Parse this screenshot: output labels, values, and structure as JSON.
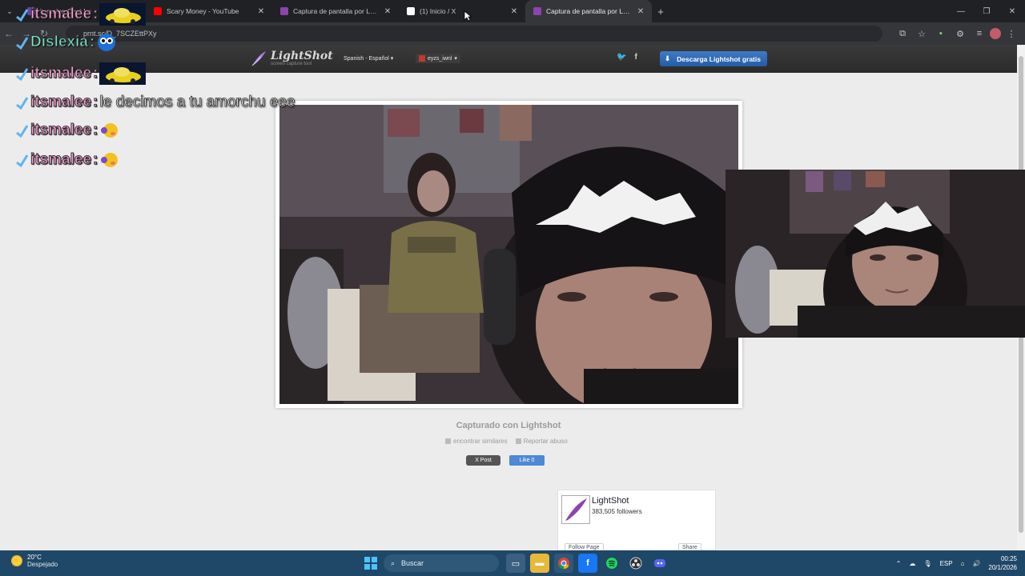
{
  "browser": {
    "tabs": [
      {
        "title": "itsmalee Chat Lo",
        "favicon_color": "#6441a5",
        "active": false
      },
      {
        "title": "Scary Money - YouTube",
        "favicon_color": "#ff0000",
        "active": false
      },
      {
        "title": "Captura de pantalla por Lightsh",
        "favicon_color": "#8e44ad",
        "active": false
      },
      {
        "title": "(1) Inicio / X",
        "favicon_color": "#ffffff",
        "active": false
      },
      {
        "title": "Captura de pantalla por Lightsh",
        "favicon_color": "#8e44ad",
        "active": true
      }
    ],
    "close_glyph": "✕",
    "new_tab_glyph": "+",
    "window_controls": [
      "—",
      "❐",
      "✕"
    ],
    "url": "prnt.sc/D_7SCZEttPXy"
  },
  "lightshot": {
    "brand": "LightShot",
    "tagline": "screen capture tool",
    "language": "Spanish - Español",
    "username": "eyzs_iwnl",
    "download_button": "Descarga Lightshot gratis",
    "captured_text": "Capturado con Lightshot",
    "find_similar": "encontrar similares",
    "report_abuse": "Reportar abuso",
    "x_post": "X Post",
    "fb_like": "Like 0"
  },
  "fb_widget": {
    "page_name": "LightShot",
    "followers": "383,505 followers",
    "follow_label": "Follow Page",
    "share_label": "Share"
  },
  "chat": [
    {
      "user": "itsmalee",
      "message": "",
      "emote": "car",
      "name_color": "#ff9ad6"
    },
    {
      "user": "Dislexia",
      "message": "",
      "emote": "ghost",
      "name_color": "#6fe8c8"
    },
    {
      "user": "itsmalee",
      "message": "",
      "emote": "car",
      "name_color": "#ff9ad6"
    },
    {
      "user": "itsmalee",
      "message": "le decimos a tu amorchu eee",
      "emote": "",
      "name_color": "#ff9ad6"
    },
    {
      "user": "itsmalee",
      "message": "",
      "emote": "blush",
      "name_color": "#ff9ad6"
    },
    {
      "user": "itsmalee",
      "message": "",
      "emote": "blush",
      "name_color": "#ff9ad6"
    }
  ],
  "taskbar": {
    "temperature": "20°C",
    "weather": "Despejado",
    "search_placeholder": "Buscar",
    "language": "ESP",
    "time": "00:25",
    "date": "20/1/2026"
  }
}
